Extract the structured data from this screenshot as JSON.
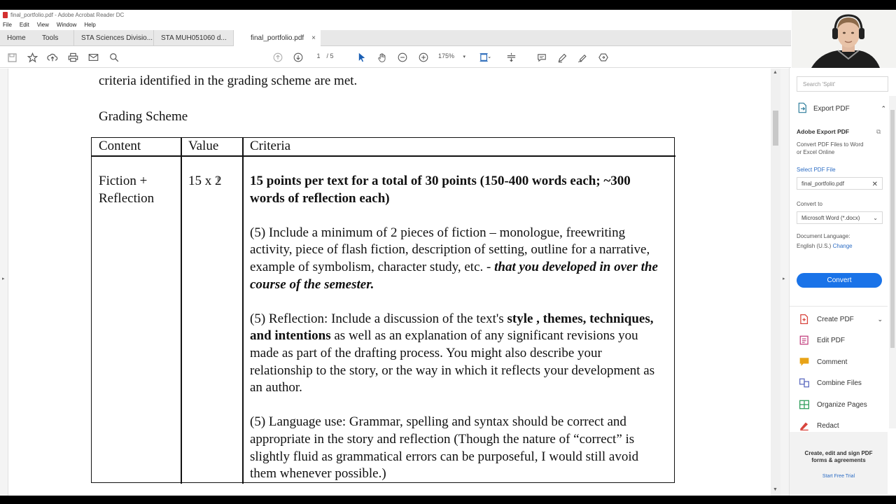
{
  "window": {
    "title": "final_portfolio.pdf - Adobe Acrobat Reader DC"
  },
  "menu": [
    "File",
    "Edit",
    "View",
    "Window",
    "Help"
  ],
  "tabs": {
    "home": "Home",
    "tools": "Tools",
    "docs": [
      "STA Sciences Divisio...",
      "STA MUH051060 d...",
      "final_portfolio.pdf"
    ],
    "close_glyph": "×"
  },
  "toolbar": {
    "page_current": "1",
    "page_total": "/ 5",
    "zoom": "175%"
  },
  "document": {
    "intro_line": "criteria identified in the grading scheme are met.",
    "heading": "Grading Scheme",
    "table": {
      "headers": [
        "Content",
        "Value",
        "Criteria"
      ],
      "content_cell": [
        "Fiction +",
        "Reflection"
      ],
      "value_cell": "15 x 2",
      "criteria": {
        "lead_bold": "15 points per text for a total of 30 points (150-400 words each; ~300 words of reflection each)",
        "p1_text": "(5) Include a minimum of 2 pieces of fiction – monologue, freewriting activity, piece of flash fiction, description of setting, outline for a narrative, example of symbolism, character study, etc. -",
        "p1_emph": "that you developed in over the course of the semester.",
        "p2_a": "(5) Reflection: Include a discussion of the text's",
        "p2_bold": "style , themes, techniques, and intentions",
        "p2_b": "as well as an explanation of any significant  revisions you made as part of the drafting process. You might also describe  your relationship to the story, or the way in which it reflects your development as an author.",
        "p3": "(5) Language use: Grammar, spelling and syntax should be correct and appropriate in the story and reflection (Though the nature of “correct” is slightly fluid as grammatical errors can be purposeful, I would still avoid them whenever possible.)"
      }
    }
  },
  "panel": {
    "search_placeholder": "Search 'Split'",
    "export_label": "Export PDF",
    "adobe_export_title": "Adobe Export PDF",
    "adobe_export_desc_1": "Convert PDF Files to Word",
    "adobe_export_desc_2": "or Excel Online",
    "select_file": "Select PDF File",
    "file_name": "final_portfolio.pdf",
    "convert_to": "Convert to",
    "convert_format": "Microsoft Word (*.docx)",
    "doc_language_label": "Document Language:",
    "doc_language": "English (U.S.)",
    "change": "Change",
    "convert_button": "Convert",
    "tools": [
      "Create PDF",
      "Edit PDF",
      "Comment",
      "Combine Files",
      "Organize Pages",
      "Redact"
    ],
    "footer_line1": "Create, edit and sign PDF",
    "footer_line2": "forms & agreements",
    "trial": "Start Free Trial"
  },
  "colors": {
    "accent": "#1a73e8",
    "create_pdf": "#d8443c",
    "edit_pdf": "#c2407e",
    "comment": "#e8a317",
    "combine": "#5c6bc0",
    "organize": "#2e9e5b",
    "redact": "#d8443c"
  }
}
